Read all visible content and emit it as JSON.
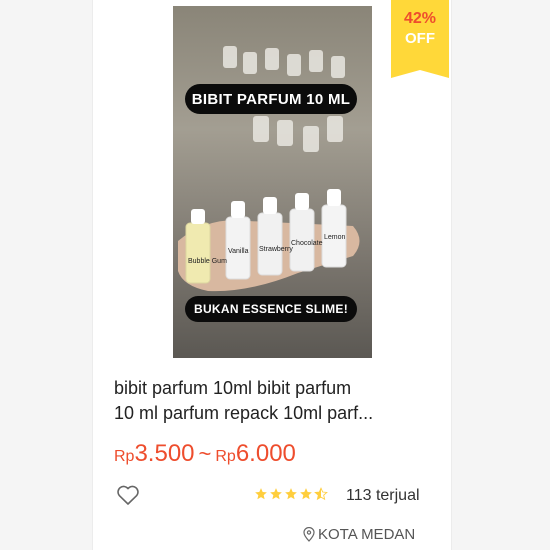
{
  "product": {
    "image": {
      "caption_top": "BIBIT PARFUM 10 ML",
      "caption_bottom": "BUKAN ESSENCE SLIME!",
      "bottle_labels": [
        "Bubble Gum",
        "Vanilla",
        "Strawberry",
        "Chocolate",
        "Lemon"
      ]
    },
    "discount": {
      "percent": "42%",
      "label": "OFF",
      "bg_color": "#ffd839",
      "text_color": "#ee4d2d"
    },
    "title_lines": [
      "bibit parfum 10ml bibit parfum",
      "10 ml parfum repack 10ml parf..."
    ],
    "price": {
      "currency_1": "Rp",
      "min": "3.500",
      "separator": "~",
      "currency_2": "Rp",
      "max": "6.000",
      "color": "#ee4d2d"
    },
    "rating": {
      "stars": 4.5,
      "max": 5,
      "star_color": "#ffce3d"
    },
    "sold": "113 terjual",
    "location": "KOTA MEDAN",
    "icons": {
      "like": "heart-outline-icon",
      "location": "location-pin-icon"
    }
  }
}
